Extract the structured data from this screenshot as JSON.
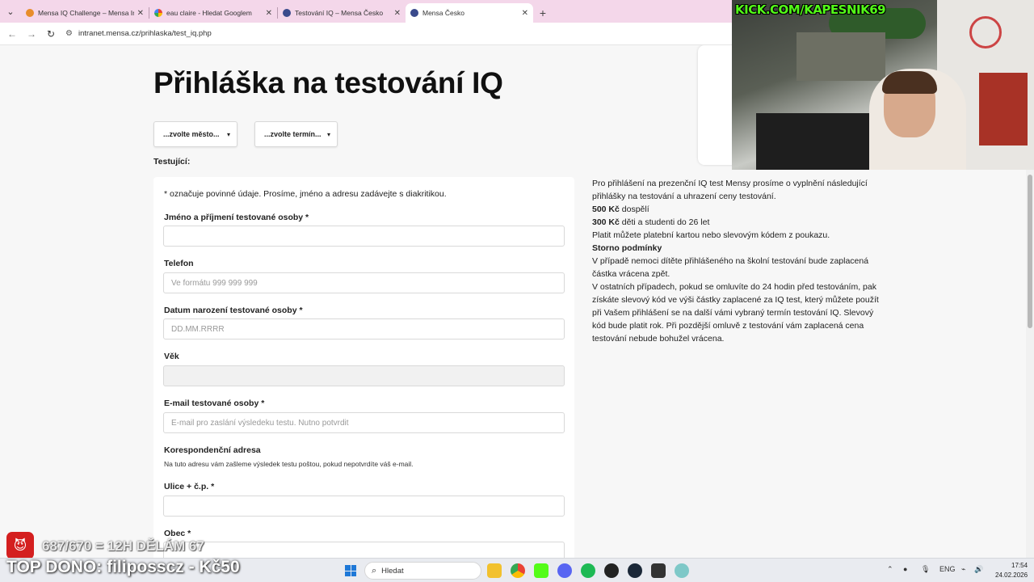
{
  "browser": {
    "tabs": [
      {
        "title": "Mensa IQ Challenge – Mensa In",
        "favicon_color": "#e88d2b",
        "active": false
      },
      {
        "title": "eau claire - Hledat Googlem",
        "favicon_color": "#4285f4",
        "active": false
      },
      {
        "title": "Testování IQ – Mensa Česko",
        "favicon_color": "#3a4a8c",
        "active": false
      },
      {
        "title": "Mensa Česko",
        "favicon_color": "#3a4a8c",
        "active": true
      }
    ],
    "url": "intranet.mensa.cz/prihlaska/test_iq.php"
  },
  "page": {
    "heading": "Přihláška na testování IQ",
    "select_city": "...zvolte město...",
    "select_term": "...zvolte termín...",
    "section_label": "Testující:",
    "required_note": "* označuje povinné údaje. Prosíme, jméno a adresu zadávejte s diakritikou.",
    "fields": {
      "name_label": "Jméno a příjmení testované osoby *",
      "name_value": "",
      "phone_label": "Telefon",
      "phone_placeholder": "Ve formátu 999 999 999",
      "dob_label": "Datum narození testované osoby *",
      "dob_placeholder": "DD.MM.RRRR",
      "age_label": "Věk",
      "age_value": "",
      "email_label": "E-mail testované osoby *",
      "email_placeholder": "E-mail pro zaslání výsledeku testu. Nutno potvrdit",
      "address_label": "Korespondenční adresa",
      "address_hint": "Na tuto adresu vám zašleme výsledek testu poštou, pokud nepotvrdíte váš e-mail.",
      "street_label": "Ulice + č.p. *",
      "city_label": "Obec *"
    },
    "info": {
      "intro": "Pro přihlášení na prezenční IQ test Mensy prosíme o vyplnění následující přihlášky na testování a uhrazení ceny testování.",
      "price_adult_amount": "500 Kč",
      "price_adult_text": " dospělí",
      "price_child_amount": "300 Kč",
      "price_child_text": " děti a studenti do 26 let",
      "payment": "Platit můžete platební kartou nebo slevovým kódem z poukazu.",
      "storno_title": "Storno podmínky",
      "storno_1": "V případě nemoci dítěte přihlášeného na školní testování bude zaplacená částka vrácena zpět.",
      "storno_2": "V ostatních případech, pokud se omluvíte do 24 hodin před testováním, pak získáte slevový kód ve výši částky zaplacené za IQ test, který můžete použít při Vašem přihlášení se na další vámi vybraný termín testování IQ. Slevový kód bude platit rok. Při pozdější omluvě z testování vám zaplacená cena testování nebude bohužel vrácena."
    }
  },
  "stream": {
    "kick_url": "KICK.COM/KAPESNIK69",
    "goal": "687/670 = 12H DĚLÁM 67",
    "top_dono": "TOP DONO: filiposscz - Kč50"
  },
  "taskbar": {
    "search_placeholder": "Hledat",
    "lang": "ENG",
    "time": "17:54",
    "date": "24.02.2026"
  },
  "colors": {
    "tabbar": "#f4d7ea",
    "kick_green": "#53fc18",
    "accent": "#1e78d7"
  }
}
